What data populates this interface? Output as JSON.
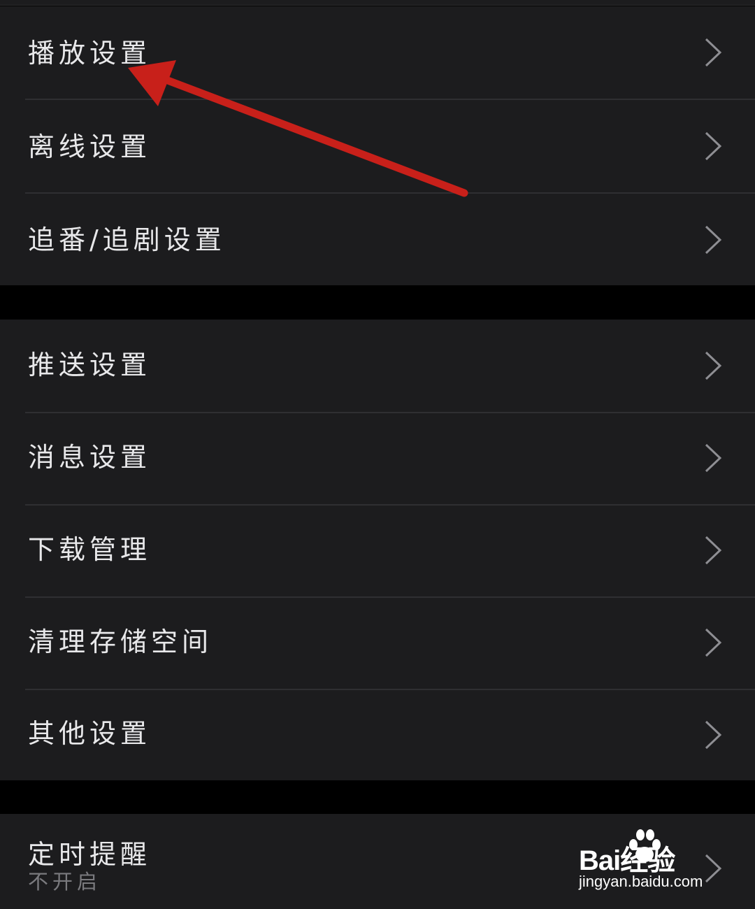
{
  "settings": {
    "group1": [
      {
        "label": "播放设置"
      },
      {
        "label": "离线设置"
      },
      {
        "label": "追番/追剧设置"
      }
    ],
    "group2": [
      {
        "label": "推送设置"
      },
      {
        "label": "消息设置"
      },
      {
        "label": "下载管理"
      },
      {
        "label": "清理存储空间"
      },
      {
        "label": "其他设置"
      }
    ],
    "group3": [
      {
        "label": "定时提醒",
        "value": "不开启"
      }
    ]
  },
  "icons": {
    "row_chevron": "chevron-right-icon",
    "annotation": "red-arrow-icon"
  },
  "colors": {
    "background": "#000000",
    "group_background": "#1c1c1e",
    "text_primary": "#e8e8ea",
    "text_secondary": "#7a7a7e",
    "chevron": "#8e8e93",
    "annotation_arrow": "#c8201a"
  },
  "watermark": {
    "brand": "Bai经验",
    "url": "jingyan.baidu.com"
  }
}
